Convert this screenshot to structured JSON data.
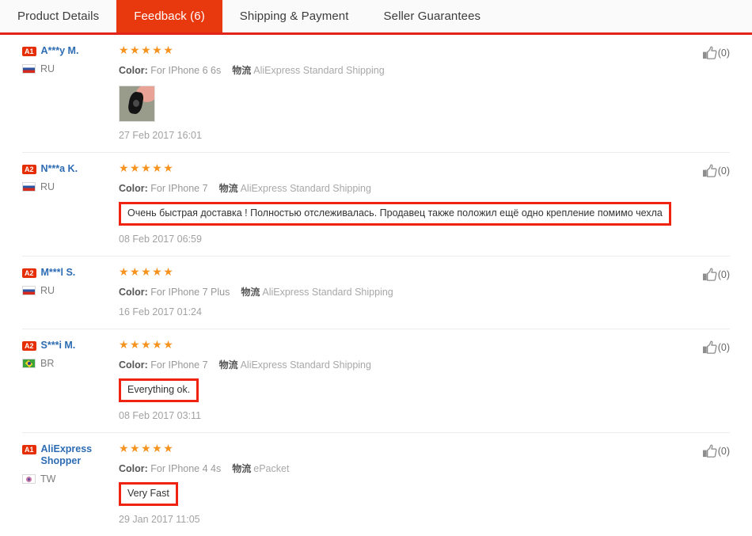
{
  "tabs": [
    {
      "label": "Product Details",
      "active": false
    },
    {
      "label": "Feedback (6)",
      "active": true
    },
    {
      "label": "Shipping & Payment",
      "active": false
    },
    {
      "label": "Seller Guarantees",
      "active": false
    }
  ],
  "colors": {
    "active_tab_bg": "#e8380d",
    "underline": "#e2231a",
    "annotation_box": "#ee2411",
    "star": "#f6921e",
    "buyer_name": "#2d6cb3",
    "badge_bg": "#e62e04"
  },
  "labels": {
    "color_label": "Color:",
    "logistics_label": "物流",
    "thumb_icon": "thumbs-up-icon"
  },
  "reviews": [
    {
      "level": "A1",
      "name": "A***y M.",
      "country": "RU",
      "flag": "flag-ru",
      "stars": "★★★★★",
      "color_value": "For IPhone 6 6s",
      "logistics": "AliExpress Standard Shipping",
      "comment": "",
      "comment_boxed": false,
      "has_photo": true,
      "date": "27 Feb 2017 16:01",
      "helpful": "(0)"
    },
    {
      "level": "A2",
      "name": "N***a K.",
      "country": "RU",
      "flag": "flag-ru",
      "stars": "★★★★★",
      "color_value": "For IPhone 7",
      "logistics": "AliExpress Standard Shipping",
      "comment": "Очень быстрая доставка ! Полностью отслеживалась. Продавец также положил ещё одно крепление помимо чехла",
      "comment_boxed": true,
      "has_photo": false,
      "date": "08 Feb 2017 06:59",
      "helpful": "(0)"
    },
    {
      "level": "A2",
      "name": "M***l S.",
      "country": "RU",
      "flag": "flag-ru",
      "stars": "★★★★★",
      "color_value": "For IPhone 7 Plus",
      "logistics": "AliExpress Standard Shipping",
      "comment": "",
      "comment_boxed": false,
      "has_photo": false,
      "date": "16 Feb 2017 01:24",
      "helpful": "(0)"
    },
    {
      "level": "A2",
      "name": "S***i M.",
      "country": "BR",
      "flag": "flag-br",
      "stars": "★★★★★",
      "color_value": "For IPhone 7",
      "logistics": "AliExpress Standard Shipping",
      "comment": "Everything ok.",
      "comment_boxed": true,
      "has_photo": false,
      "date": "08 Feb 2017 03:11",
      "helpful": "(0)"
    },
    {
      "level": "A1",
      "name": "AliExpress Shopper",
      "country": "TW",
      "flag": "flag-tw",
      "stars": "★★★★★",
      "color_value": "For IPhone 4 4s",
      "logistics": "ePacket",
      "comment": "Very Fast",
      "comment_boxed": true,
      "has_photo": false,
      "date": "29 Jan 2017 11:05",
      "helpful": "(0)"
    }
  ]
}
